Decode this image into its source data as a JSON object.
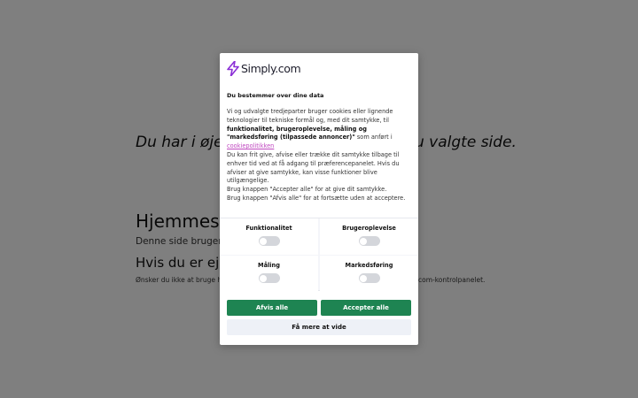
{
  "background": {
    "hero_left": "Du har i øjeb",
    "hero_right": "u valgte side.",
    "heading": "Hjemmesi",
    "paragraph": "Denne side bruger Si",
    "subheading": "Hvis du er ejer",
    "small_left": "Ønsker du ikke at bruge h",
    "small_right": "com-kontrolpanelet."
  },
  "dialog": {
    "brand": "Simply.com",
    "brand_color": "#8b2fd6",
    "title": "Du bestemmer over dine data",
    "body": {
      "p1_start": "Vi og udvalgte tredjeparter bruger cookies eller lignende teknologier til tekniske formål og, med dit samtykke, til",
      "p1_bold": "funktionalitet, brugeroplevelse, måling og \"markedsføring (tilpassede annoncer)\"",
      "p1_mid": "som anført i",
      "link": "cookiepolitikken",
      "p2": "Du kan frit give, afvise eller trække dit samtykke tilbage til enhver tid ved at få adgang til præferencepanelet. Hvis du afviser at give samtykke, kan visse funktioner blive utilgængelige.",
      "p3": "Brug knappen \"Accepter alle\" for at give dit samtykke.",
      "p4": "Brug knappen \"Afvis alle\" for at fortsætte uden at acceptere."
    },
    "toggles": [
      {
        "label": "Funktionalitet",
        "checked": false
      },
      {
        "label": "Brugeroplevelse",
        "checked": false
      },
      {
        "label": "Måling",
        "checked": false
      },
      {
        "label": "Markedsføring",
        "checked": false
      }
    ],
    "buttons": {
      "reject": "Afvis alle",
      "accept": "Accepter alle",
      "more": "Få mere at vide"
    },
    "accent_color": "#1e8452"
  }
}
